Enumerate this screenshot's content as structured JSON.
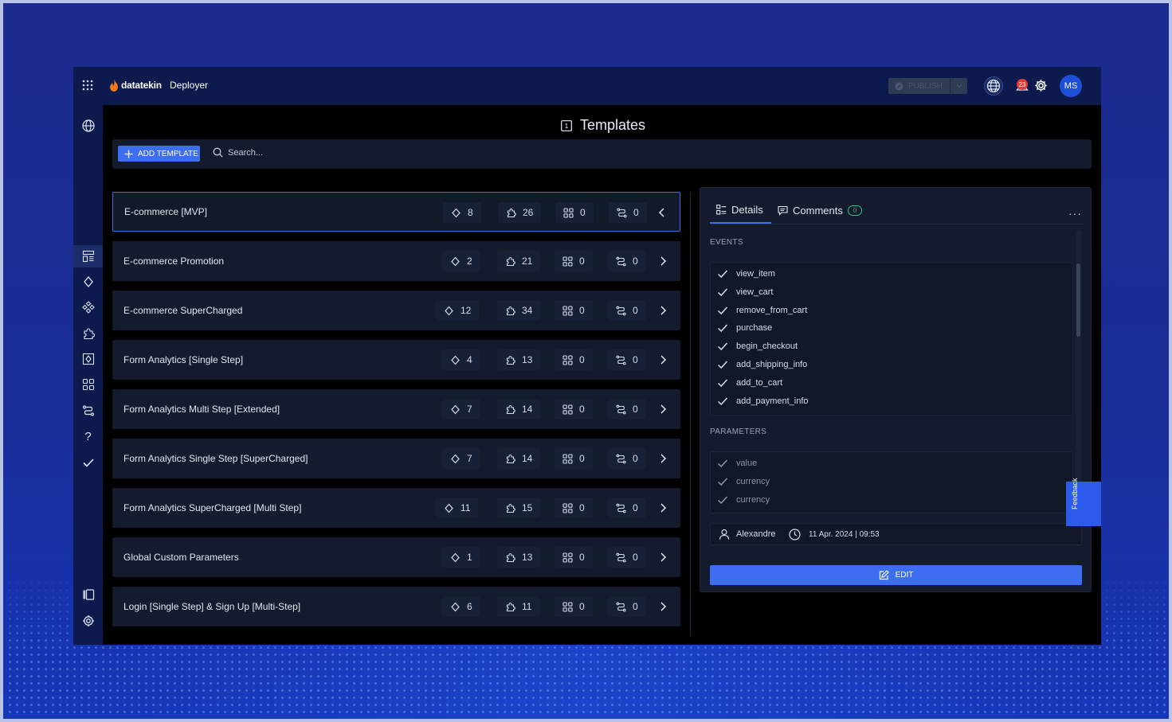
{
  "topbar": {
    "brand": "datatekin",
    "product": "Deployer",
    "publish_label": "PUBLISH",
    "notifications": "23",
    "avatar_initials": "MS"
  },
  "page": {
    "title": "Templates",
    "title_icon_text": "1"
  },
  "toolbar": {
    "add_label": "ADD TEMPLATE",
    "search_placeholder": "Search..."
  },
  "templates": [
    {
      "name": "E-commerce [MVP]",
      "tags": "8",
      "variables": "26",
      "triggers": "0",
      "workflows": "0",
      "expanded": true
    },
    {
      "name": "E-commerce  Promotion",
      "tags": "2",
      "variables": "21",
      "triggers": "0",
      "workflows": "0"
    },
    {
      "name": "E-commerce SuperCharged",
      "tags": "12",
      "variables": "34",
      "triggers": "0",
      "workflows": "0"
    },
    {
      "name": "Form Analytics [Single Step]",
      "tags": "4",
      "variables": "13",
      "triggers": "0",
      "workflows": "0"
    },
    {
      "name": "Form Analytics  Multi Step [Extended]",
      "tags": "7",
      "variables": "14",
      "triggers": "0",
      "workflows": "0"
    },
    {
      "name": "Form Analytics Single Step [SuperCharged]",
      "tags": "7",
      "variables": "14",
      "triggers": "0",
      "workflows": "0"
    },
    {
      "name": "Form Analytics SuperCharged [Multi Step]",
      "tags": "11",
      "variables": "15",
      "triggers": "0",
      "workflows": "0"
    },
    {
      "name": "Global Custom  Parameters",
      "tags": "1",
      "variables": "13",
      "triggers": "0",
      "workflows": "0"
    },
    {
      "name": "Login [Single Step] & Sign Up [Multi-Step]",
      "tags": "6",
      "variables": "11",
      "triggers": "0",
      "workflows": "0"
    }
  ],
  "details": {
    "tab_details": "Details",
    "tab_comments": "Comments",
    "comments_count": "0",
    "more": "···",
    "events_label": "EVENTS",
    "events": [
      "view_item",
      "view_cart",
      "remove_from_cart",
      "purchase",
      "begin_checkout",
      "add_shipping_info",
      "add_to_cart",
      "add_payment_info"
    ],
    "parameters_label": "PARAMETERS",
    "parameters": [
      "value",
      "currency",
      "currency"
    ],
    "author": "Alexandre",
    "date": "11 Apr. 2024 | 09:53",
    "edit_label": "EDIT"
  },
  "feedback_label": "Feedback",
  "colors": {
    "accent": "#3d6ef0",
    "topbar": "#0c1a4d",
    "badge_green": "#2fbf83",
    "notif_red": "#e53935"
  }
}
